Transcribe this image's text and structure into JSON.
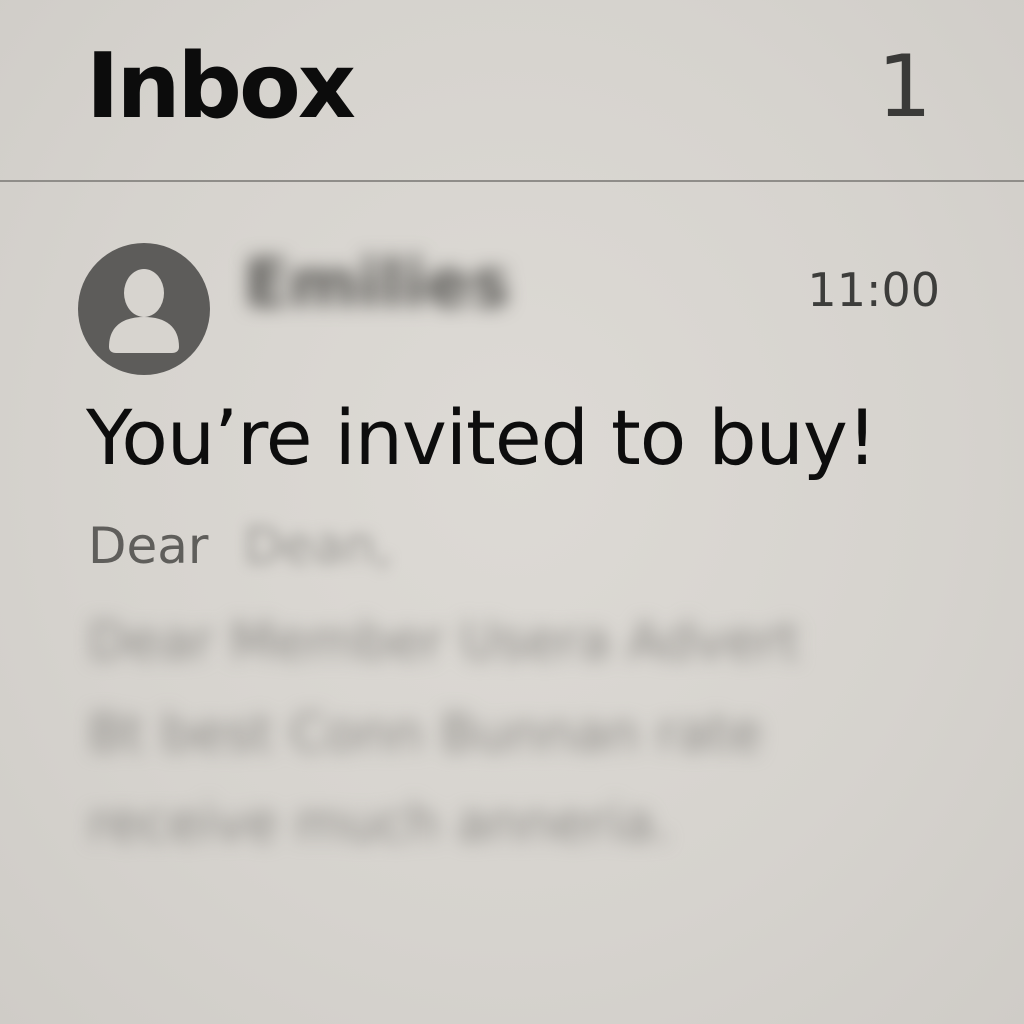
{
  "header": {
    "title": "Inbox",
    "unread_count": "1"
  },
  "message": {
    "avatar_icon": "person-icon",
    "sender": "Emilies",
    "time": "11:00",
    "subject": "You’re invited to buy!",
    "greeting": "Dear",
    "greeting_name": "Dean,",
    "preview_lines": [
      "Dear Member Usera Advert",
      "Bt best Conn Bunnan rate",
      "receive much anneria."
    ]
  },
  "colors": {
    "background": "#d8d5d0",
    "divider": "#8f8d89",
    "avatar": "#5d5c5a",
    "text_primary": "#0c0c0c",
    "text_secondary": "#5f5e5b"
  }
}
